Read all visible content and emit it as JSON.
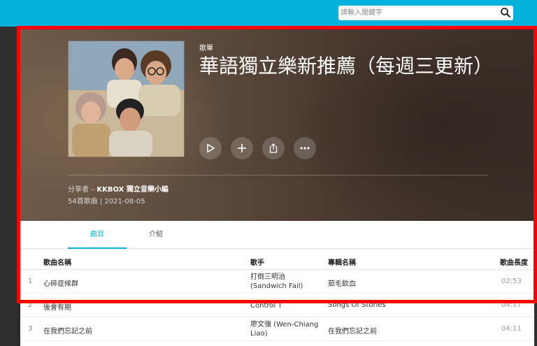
{
  "search": {
    "placeholder": "請輸入關鍵字",
    "icon": "search-icon"
  },
  "playlist": {
    "type_label": "歌單",
    "title": "華語獨立樂新推薦（每週三更新）",
    "sharer_prefix": "分享者 – ",
    "sharer_name": "KKBOX 獨立音樂小編",
    "meta": "54首歌曲 | 2021-08-05",
    "actions": [
      "play-icon",
      "add-icon",
      "share-icon",
      "more-icon"
    ]
  },
  "tabs": [
    {
      "label": "曲目",
      "active": true
    },
    {
      "label": "介紹",
      "active": false
    }
  ],
  "table": {
    "columns": [
      "歌曲名稱",
      "歌手",
      "專輯名稱",
      "歌曲長度"
    ],
    "rows": [
      {
        "num": "1",
        "title": "心碎症候群",
        "artist": "打倒三明治\n(Sandwich Fail)",
        "album": "茹毛飲血",
        "duration": "02:53"
      },
      {
        "num": "2",
        "title": "後會有期",
        "artist": "Control T",
        "album": "Songs Of Stories",
        "duration": "04:17"
      },
      {
        "num": "3",
        "title": "在我們忘記之前",
        "artist": "廖文強 (Wen-Chiang\nLiao)",
        "album": "在我們忘記之前",
        "duration": "04:11"
      }
    ]
  },
  "colors": {
    "accent": "#06b2dd",
    "highlight_frame": "#ff0000"
  }
}
